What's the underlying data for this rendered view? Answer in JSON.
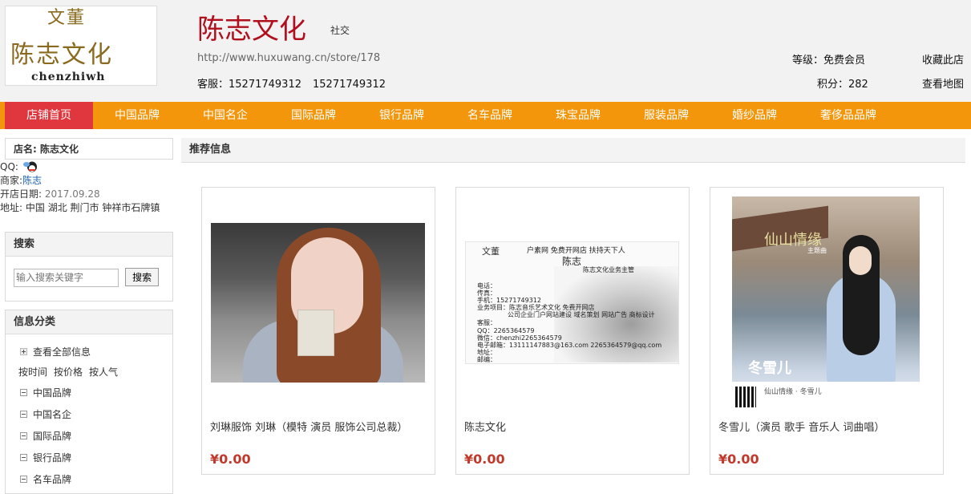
{
  "header": {
    "logo_top": "文董",
    "logo_mid": "陈志文化",
    "logo_bottom": "chenzhiwh",
    "store_name": "陈志文化",
    "store_type": "社交",
    "store_url": "http://www.huxuwang.cn/store/178",
    "service_label": "客服：",
    "phone_1": "15271749312",
    "phone_2": "15271749312",
    "level": "等级：免费会员",
    "score": "积分：282",
    "favorite": "收藏此店",
    "map": "查看地图"
  },
  "nav": [
    {
      "label": "店铺首页",
      "active": true
    },
    {
      "label": "中国品牌"
    },
    {
      "label": "中国名企"
    },
    {
      "label": "国际品牌"
    },
    {
      "label": "银行品牌"
    },
    {
      "label": "名车品牌"
    },
    {
      "label": "珠宝品牌"
    },
    {
      "label": "服装品牌"
    },
    {
      "label": "婚纱品牌"
    },
    {
      "label": "奢侈品品牌"
    }
  ],
  "store_info": {
    "name_label": "店名:",
    "name_value": "陈志文化",
    "qq_label": "QQ:",
    "merchant_label": "商家:",
    "merchant_value": "陈志",
    "open_label": "开店日期:",
    "open_value": "2017.09.28",
    "address_label": "地址:",
    "address_value": "中国 湖北 荆门市 钟祥市石牌镇"
  },
  "search": {
    "title": "搜索",
    "placeholder": "输入搜索关键字",
    "button": "搜索"
  },
  "categories": {
    "title": "信息分类",
    "all": "查看全部信息",
    "sort": [
      "按时间",
      "按价格",
      "按人气"
    ],
    "items": [
      "中国品牌",
      "中国名企",
      "国际品牌",
      "银行品牌",
      "名车品牌"
    ]
  },
  "recommend": {
    "title": "推荐信息",
    "cards": [
      {
        "name": "刘琳服饰 刘琳（模特 演员 服饰公司总裁）",
        "price": "¥0.00"
      },
      {
        "name": "陈志文化",
        "price": "¥0.00"
      },
      {
        "name": "冬雪儿（演员 歌手 音乐人 词曲唱）",
        "price": "¥0.00"
      }
    ]
  },
  "business_card": {
    "slogan": "户素网 免费开网店 扶持天下人",
    "person": "陈志",
    "position": "陈志文化业务主管",
    "lines": [
      "电话：",
      "传真：",
      "手机：15271749312",
      "业务项目：陈志音乐艺术文化 免费开网店",
      "公司企业门户网站建设 域名策划 网站广告 商标设计",
      "客服：",
      "QQ：2265364579",
      "微信：chenzhi2265364579",
      "电子邮箱：13111147883@163.com   2265364579@qq.com",
      "地址：",
      "邮编："
    ]
  },
  "poster": {
    "title": "仙山情缘",
    "subtitle": "主题曲",
    "song": "冬雪儿",
    "footer": "仙山情缘 · 冬雪儿"
  },
  "colors": {
    "nav_bg": "#f4960b",
    "nav_active": "#e0363d",
    "title_red": "#b0101e",
    "price_red": "#c0392b"
  }
}
